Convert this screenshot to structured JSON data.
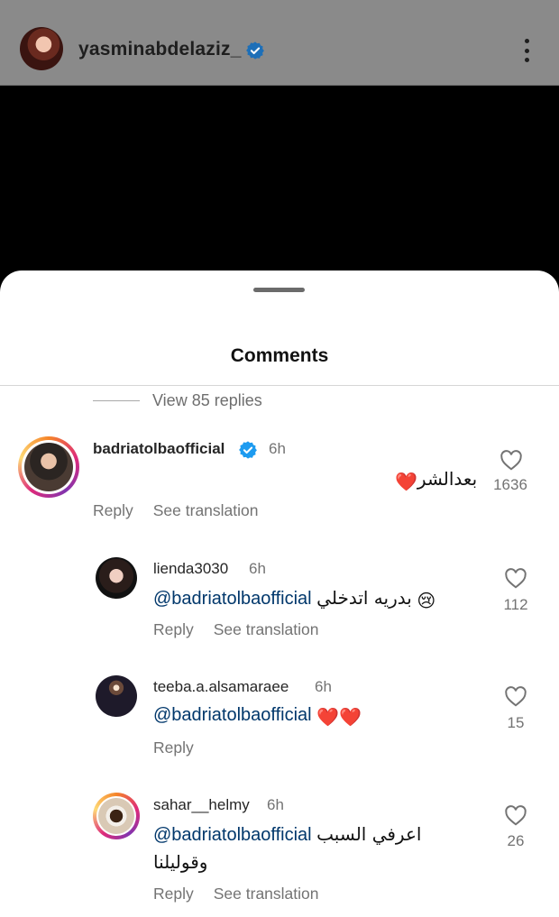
{
  "post_header": {
    "username": "yasminabdelaziz_",
    "verified": true,
    "avatar": "profile-photo",
    "more_icon": "three-dots-vertical-icon"
  },
  "sheet": {
    "title": "Comments",
    "view_replies": "View 85 replies"
  },
  "comments": [
    {
      "username": "badriatolbaofficial",
      "verified": true,
      "time": "6h",
      "mention": "",
      "text": "بعدالشر",
      "emoji": "❤️",
      "reply_label": "Reply",
      "translate_label": "See translation",
      "likes": "1636",
      "story_ring": true
    },
    {
      "username": "lienda3030",
      "time": "6h",
      "mention": "@badriatolbaofficial",
      "text": "بدريه اتدخلي",
      "emoji": "😢",
      "reply_label": "Reply",
      "translate_label": "See translation",
      "likes": "112"
    },
    {
      "username": "teeba.a.alsamaraee",
      "time": "6h",
      "mention": "@badriatolbaofficial",
      "text": "",
      "emoji": "❤️❤️",
      "reply_label": "Reply",
      "likes": "15"
    },
    {
      "username": "sahar__helmy",
      "time": "6h",
      "mention": "@badriatolbaofficial",
      "text": "اعرفي السبب",
      "text_line2": "وقوليلنا",
      "reply_label": "Reply",
      "translate_label": "See translation",
      "likes": "26",
      "story_ring": true
    }
  ],
  "colors": {
    "mention": "#00376b",
    "secondary_text": "#737373",
    "verified_badge": "#1d9bf0"
  }
}
